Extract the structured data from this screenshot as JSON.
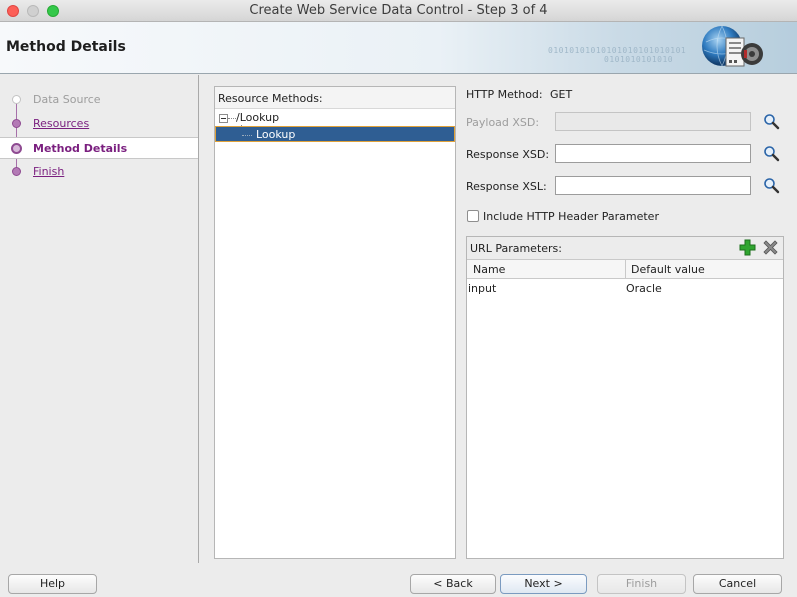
{
  "window": {
    "title": "Create Web Service Data Control - Step 3 of 4"
  },
  "header": {
    "title": "Method Details",
    "binary_text_1": "01010101010101010101010101",
    "binary_text_2": "0101010101010"
  },
  "steps": [
    {
      "label": "Data Source",
      "state": "done"
    },
    {
      "label": "Resources",
      "state": "link"
    },
    {
      "label": "Method Details",
      "state": "current"
    },
    {
      "label": "Finish",
      "state": "link"
    }
  ],
  "resource_methods": {
    "label": "Resource Methods:",
    "root": "/Lookup",
    "child": "Lookup"
  },
  "form": {
    "http_method_label": "HTTP Method:",
    "http_method_value": "GET",
    "payload_xsd_label": "Payload XSD:",
    "payload_xsd_value": "",
    "response_xsd_label": "Response XSD:",
    "response_xsd_value": "",
    "response_xsl_label": "Response XSL:",
    "response_xsl_value": "",
    "include_header_label": "Include HTTP Header Parameter",
    "include_header_checked": false
  },
  "url_parameters": {
    "label": "URL Parameters:",
    "columns": [
      "Name",
      "Default value"
    ],
    "rows": [
      {
        "name": "input",
        "default": "Oracle"
      }
    ]
  },
  "buttons": {
    "help": "Help",
    "back": "< Back",
    "next": "Next >",
    "finish": "Finish",
    "cancel": "Cancel"
  },
  "colors": {
    "accent_purple": "#7a1f7f",
    "selection_blue": "#2f5e93",
    "add_green": "#2fa52f"
  }
}
